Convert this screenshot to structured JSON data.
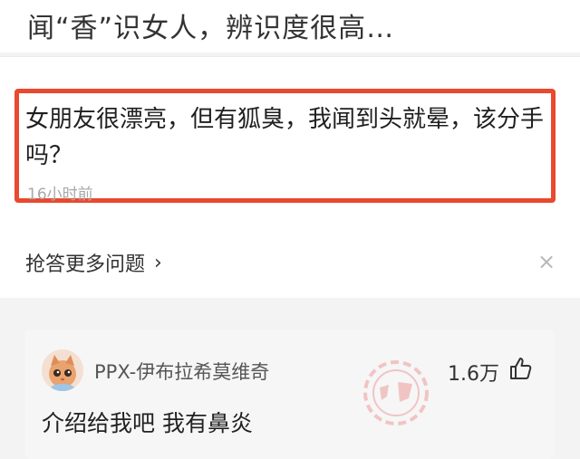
{
  "header": {
    "title": "闻“香”识女人，辨识度很高…"
  },
  "question": {
    "text": "女朋友很漂亮，但有狐臭，我闻到头就晕，该分手吗？",
    "time": "16小时前"
  },
  "more": {
    "label": "抢答更多问题",
    "chevron": "›",
    "close": "×"
  },
  "comment": {
    "username": "PPX-伊布拉希莫维奇",
    "likes": "1.6万",
    "text": "介绍给我吧 我有鼻炎",
    "stamp_text": "神评"
  },
  "colors": {
    "highlight": "#e8492f",
    "stamp": "#e86a6a"
  }
}
